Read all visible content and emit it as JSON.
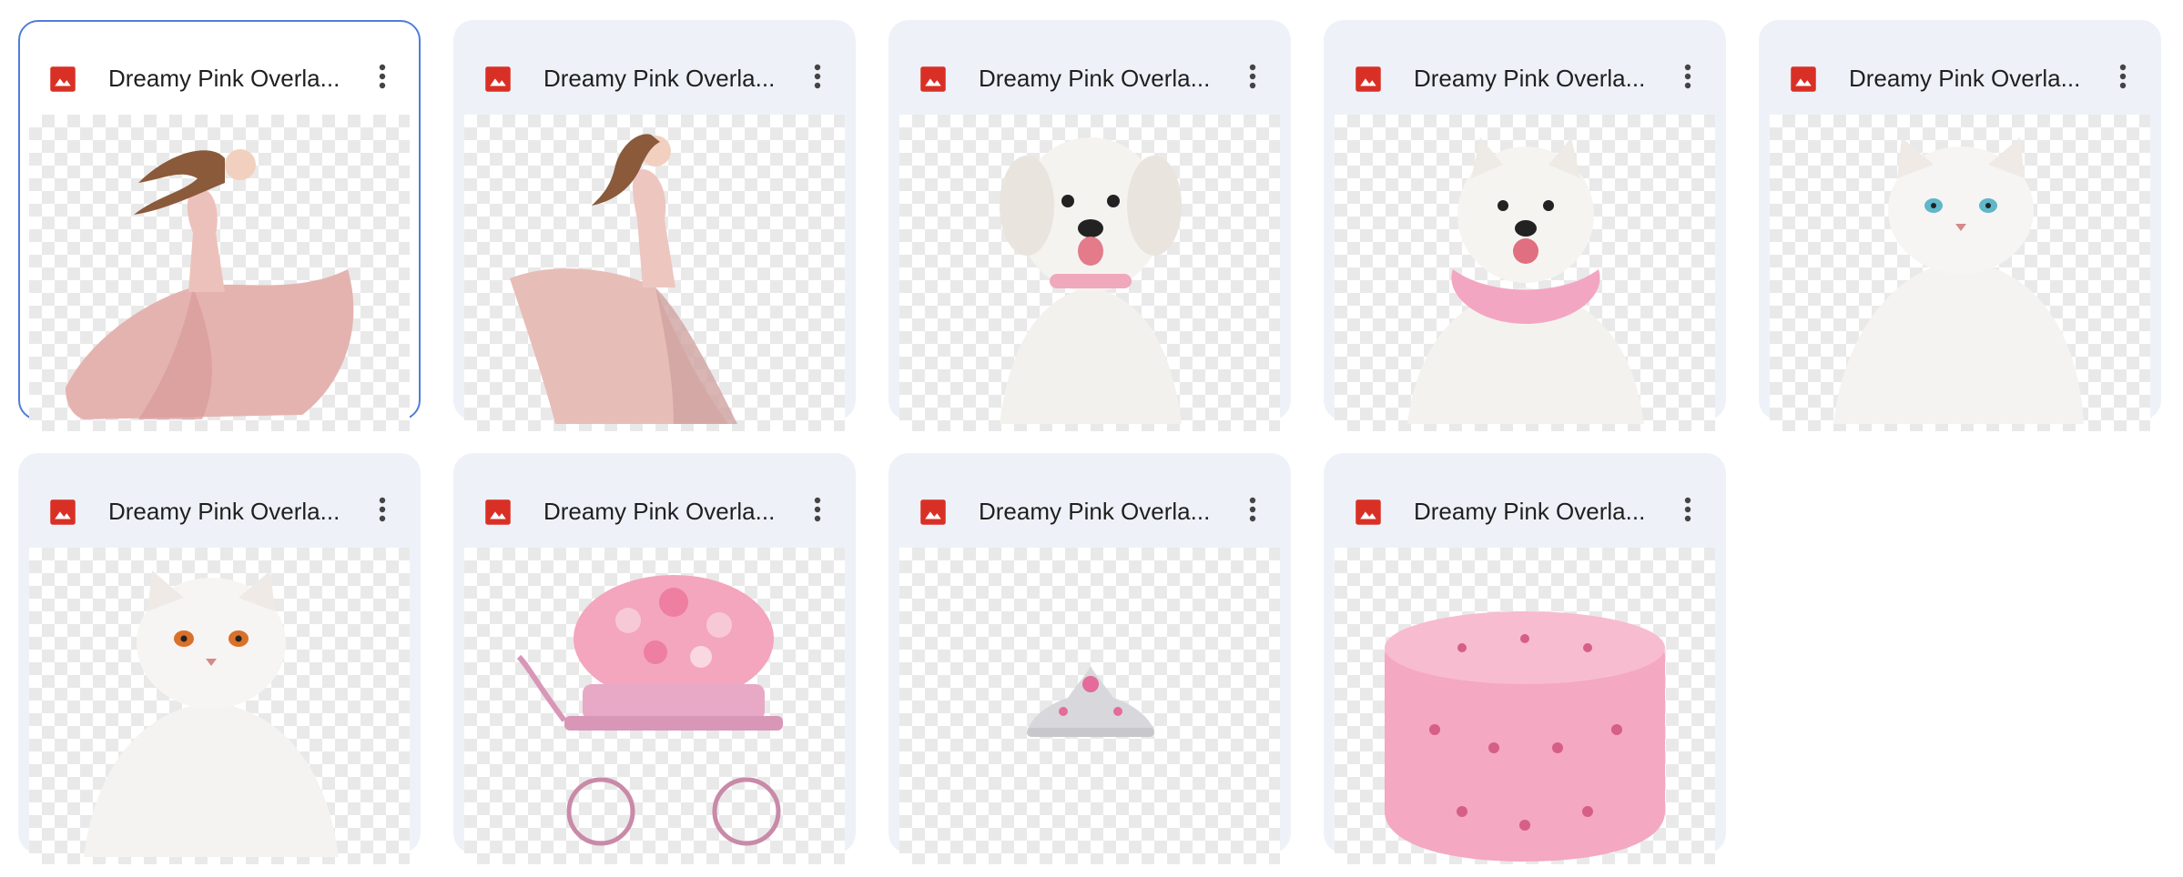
{
  "files": [
    {
      "name": "Dreamy Pink Overla...",
      "subject": "girl-pink-dress-left"
    },
    {
      "name": "Dreamy Pink Overla...",
      "subject": "girl-pink-dress-right"
    },
    {
      "name": "Dreamy Pink Overla...",
      "subject": "white-dog"
    },
    {
      "name": "Dreamy Pink Overla...",
      "subject": "samoyed-pink-collar"
    },
    {
      "name": "Dreamy Pink Overla...",
      "subject": "white-cat-blue-eyes"
    },
    {
      "name": "Dreamy Pink Overla...",
      "subject": "white-cat-orange-eyes"
    },
    {
      "name": "Dreamy Pink Overla...",
      "subject": "flower-carriage"
    },
    {
      "name": "Dreamy Pink Overla...",
      "subject": "tiara"
    },
    {
      "name": "Dreamy Pink Overla...",
      "subject": "pink-pouf"
    }
  ],
  "icons": {
    "file_type": "image-file-icon",
    "more": "more-vert-icon"
  },
  "colors": {
    "card_bg": "#eef2f8",
    "selected_border": "#4f7ddb",
    "image_icon": "#d93025"
  }
}
